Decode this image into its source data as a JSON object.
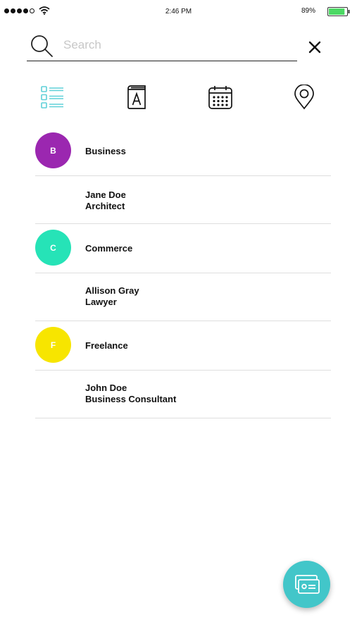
{
  "status_bar": {
    "time": "2:46 PM",
    "battery_percent": "89%",
    "battery_level": 0.89,
    "signal_bars_filled": 4,
    "signal_bars_total": 5,
    "icons": [
      "signal-dots-icon",
      "wifi-icon",
      "battery-icon"
    ]
  },
  "search": {
    "placeholder": "Search",
    "value": "",
    "icon": "search-icon",
    "close_icon": "close-icon"
  },
  "filters": [
    {
      "name": "list-view",
      "icon": "list-icon",
      "active": true
    },
    {
      "name": "alphabetical",
      "icon": "address-book-icon",
      "active": false
    },
    {
      "name": "date",
      "icon": "calendar-icon",
      "active": false
    },
    {
      "name": "location",
      "icon": "location-pin-icon",
      "active": false
    }
  ],
  "groups": [
    {
      "initial": "B",
      "label": "Business",
      "color": "#9b27b0",
      "contact": {
        "name": "Jane Doe",
        "role": "Architect"
      }
    },
    {
      "initial": "C",
      "label": "Commerce",
      "color": "#26e3b7",
      "contact": {
        "name": "Allison Gray",
        "role": "Lawyer"
      }
    },
    {
      "initial": "F",
      "label": "Freelance",
      "color": "#f7e500",
      "contact": {
        "name": "John Doe",
        "role": "Business Consultant"
      }
    }
  ],
  "colors": {
    "accent": "#42c6c9",
    "active_tab": "#5fd0d8",
    "divider": "#dedede",
    "battery": "#4cd964"
  },
  "fab": {
    "icon": "contact-card-icon"
  }
}
